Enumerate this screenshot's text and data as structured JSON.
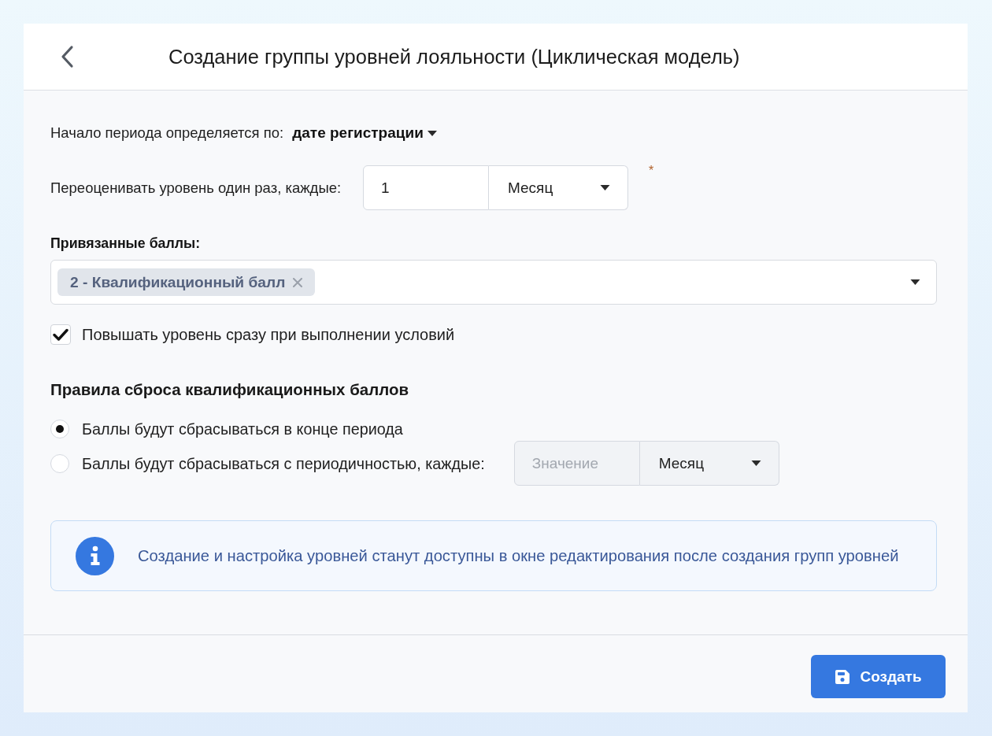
{
  "header": {
    "title": "Создание группы уровней лояльности (Циклическая модель)"
  },
  "period_start": {
    "label": "Начало периода определяется по:",
    "value": "дате регистрации"
  },
  "reevaluate": {
    "label": "Переоценивать уровень один раз, каждые:",
    "value": "1",
    "unit": "Месяц",
    "required_mark": "*"
  },
  "linked_points": {
    "label": "Привязанные баллы:",
    "tags": [
      {
        "label": "2 - Квалификационный балл"
      }
    ]
  },
  "upgrade_immediately": {
    "label": "Повышать уровень сразу при выполнении условий",
    "checked": true
  },
  "reset_rules": {
    "title": "Правила сброса квалификационных баллов",
    "options": [
      {
        "kind": "plain",
        "label": "Баллы будут сбрасываться в конце периода",
        "selected": true
      },
      {
        "kind": "interval",
        "label": "Баллы будут сбрасываться с периодичностью, каждые:",
        "selected": false,
        "placeholder": "Значение",
        "unit": "Месяц",
        "disabled": true
      }
    ]
  },
  "info": {
    "text": "Создание и настройка уровней станут доступны в окне редактирования после создания групп уровней"
  },
  "footer": {
    "buttons": [
      {
        "kind": "save",
        "label": "Создать"
      }
    ]
  }
}
